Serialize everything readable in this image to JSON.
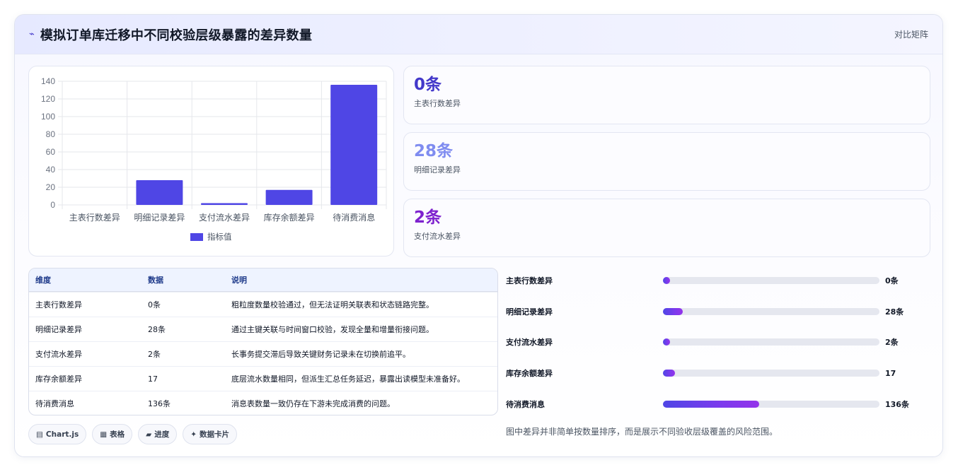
{
  "header": {
    "icon": "chart-line-icon",
    "title": "模拟订单库迁移中不同校验层级暴露的差异数量",
    "right_label": "对比矩阵"
  },
  "chart_data": {
    "type": "bar",
    "categories": [
      "主表行数差异",
      "明细记录差异",
      "支付流水差异",
      "库存余额差异",
      "待消费消息"
    ],
    "series": [
      {
        "name": "指标值",
        "values": [
          0,
          28,
          2,
          17,
          136
        ],
        "color": "#4f46e5"
      }
    ],
    "ylim": [
      0,
      140
    ],
    "yticks": [
      0,
      20,
      40,
      60,
      80,
      100,
      120,
      140
    ],
    "grid": true,
    "legend": "bottom"
  },
  "stats": [
    {
      "value": "0条",
      "label": "主表行数差异",
      "color": "#4338ca"
    },
    {
      "value": "28条",
      "label": "明细记录差异",
      "color": "#7f8cf0"
    },
    {
      "value": "2条",
      "label": "支付流水差异",
      "color": "#7e22ce"
    }
  ],
  "table": {
    "headers": [
      "维度",
      "数据",
      "说明"
    ],
    "rows": [
      [
        "主表行数差异",
        "0条",
        "粗粒度数量校验通过，但无法证明关联表和状态链路完整。"
      ],
      [
        "明细记录差异",
        "28条",
        "通过主键关联与时间窗口校验，发现全量和增量衔接问题。"
      ],
      [
        "支付流水差异",
        "2条",
        "长事务提交滞后导致关键财务记录未在切换前追平。"
      ],
      [
        "库存余额差异",
        "17",
        "底层流水数量相同，但派生汇总任务延迟，暴露出读模型未准备好。"
      ],
      [
        "待消费消息",
        "136条",
        "消息表数量一致仍存在下游未完成消费的问题。"
      ]
    ]
  },
  "tags": [
    {
      "icon": "chart-icon",
      "glyph": "▤",
      "label": "Chart.js"
    },
    {
      "icon": "table-icon",
      "glyph": "▦",
      "label": "表格"
    },
    {
      "icon": "progress-icon",
      "glyph": "▰",
      "label": "进度"
    },
    {
      "icon": "card-icon",
      "glyph": "✦",
      "label": "数据卡片"
    }
  ],
  "progress": {
    "max": 306,
    "items": [
      {
        "label": "主表行数差异",
        "value": 0,
        "display": "0条"
      },
      {
        "label": "明细记录差异",
        "value": 28,
        "display": "28条"
      },
      {
        "label": "支付流水差异",
        "value": 2,
        "display": "2条"
      },
      {
        "label": "库存余额差异",
        "value": 17,
        "display": "17"
      },
      {
        "label": "待消费消息",
        "value": 136,
        "display": "136条"
      }
    ]
  },
  "note": "图中差异并非简单按数量排序，而是展示不同验收层级覆盖的风险范围。"
}
